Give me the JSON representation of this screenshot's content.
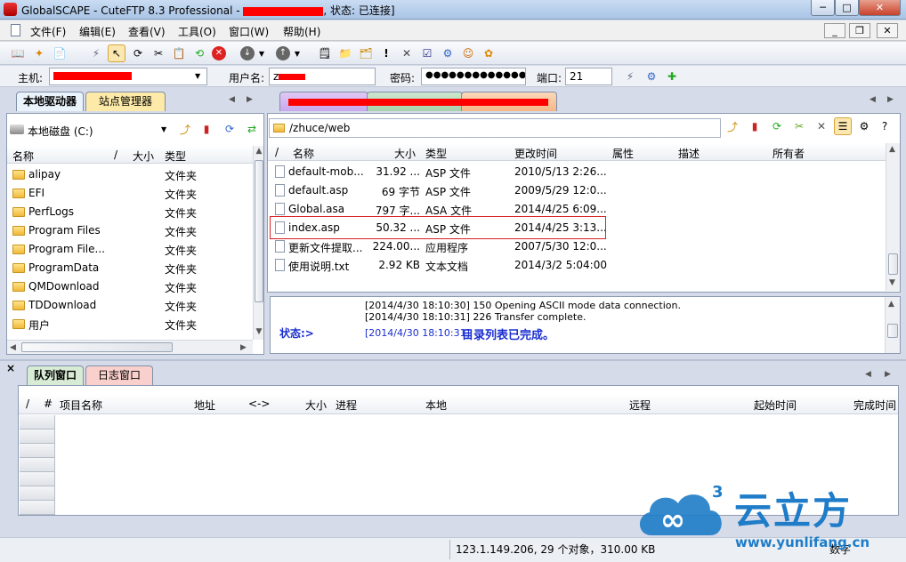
{
  "window": {
    "title_prefix": "GlobalSCAPE - CuteFTP 8.3 Professional - ",
    "title_status": ", 状态: 已连接]",
    "min_label": "─",
    "max_label": "□",
    "close_label": "✕"
  },
  "menu": {
    "items": [
      "文件(F)",
      "编辑(E)",
      "查看(V)",
      "工具(O)",
      "窗口(W)",
      "帮助(H)"
    ],
    "mdi_min": "_",
    "mdi_restore": "❐",
    "mdi_close": "✕"
  },
  "toolbar": {
    "icons": [
      "open-site-icon",
      "wand-icon",
      "new-icon",
      "connect-icon",
      "select-icon",
      "reconnect-icon",
      "disconnect-icon",
      "clipboard-icon",
      "refresh-icon",
      "stop-icon",
      "download-icon",
      "upload-icon",
      "properties-icon",
      "folder-icon",
      "exclamation-icon",
      "delete-icon",
      "edit-icon",
      "settings-icon",
      "support-icon",
      "globalscape-icon"
    ]
  },
  "connection": {
    "host_label": "主机:",
    "host_value": "",
    "user_label": "用户名:",
    "user_value": "z",
    "pass_label": "密码:",
    "pass_value": "●●●●●●●●●●●●●●",
    "port_label": "端口:",
    "port_value": "21"
  },
  "left_pane": {
    "tabs": [
      "本地驱动器",
      "站点管理器"
    ],
    "drive": "本地磁盘 (C:)",
    "columns": [
      "名称",
      "/",
      "大小",
      "类型"
    ],
    "items": [
      {
        "name": "alipay",
        "type": "文件夹"
      },
      {
        "name": "EFI",
        "type": "文件夹"
      },
      {
        "name": "PerfLogs",
        "type": "文件夹"
      },
      {
        "name": "Program Files",
        "type": "文件夹"
      },
      {
        "name": "Program File...",
        "type": "文件夹"
      },
      {
        "name": "ProgramData",
        "type": "文件夹"
      },
      {
        "name": "QMDownload",
        "type": "文件夹"
      },
      {
        "name": "TDDownload",
        "type": "文件夹"
      },
      {
        "name": "用户",
        "type": "文件夹"
      }
    ]
  },
  "right_pane": {
    "path": "/zhuce/web",
    "columns": [
      "/",
      "名称",
      "大小",
      "类型",
      "更改时间",
      "属性",
      "描述",
      "所有者"
    ],
    "files": [
      {
        "name": "default-mob...",
        "size": "31.92 ...",
        "type": "ASP 文件",
        "modified": "2010/5/13 2:26..."
      },
      {
        "name": "default.asp",
        "size": "69 字节",
        "type": "ASP 文件",
        "modified": "2009/5/29 12:0..."
      },
      {
        "name": "Global.asa",
        "size": "797 字...",
        "type": "ASA 文件",
        "modified": "2014/4/25 6:09..."
      },
      {
        "name": "index.asp",
        "size": "50.32 ...",
        "type": "ASP 文件",
        "modified": "2014/4/25 3:13...",
        "highlighted": true
      },
      {
        "name": "更新文件提取...",
        "size": "224.00...",
        "type": "应用程序",
        "modified": "2007/5/30 12:0..."
      },
      {
        "name": "使用说明.txt",
        "size": "2.92 KB",
        "type": "文本文档",
        "modified": "2014/3/2 5:04:00"
      }
    ],
    "highlight_color": "#d92020"
  },
  "log": {
    "lines": [
      "[2014/4/30 18:10:30] 150 Opening ASCII mode data connection.",
      "[2014/4/30 18:10:31] 226 Transfer complete."
    ],
    "status_label": "状态:>",
    "status_time": "[2014/4/30 18:10:31]",
    "status_msg": "目录列表已完成。"
  },
  "queue": {
    "close": "×",
    "tabs": [
      "队列窗口",
      "日志窗口"
    ],
    "columns": [
      "/",
      "#",
      "项目名称",
      "地址",
      "<->",
      "大小",
      "进程",
      "本地",
      "远程",
      "起始时间",
      "完成时间"
    ]
  },
  "statusbar": {
    "text": "123.1.149.206, 29 个对象，310.00 KB",
    "num": "数字"
  },
  "watermark": {
    "brand": "云立方",
    "url": "www.yunlifang.cn",
    "sup": "3"
  }
}
